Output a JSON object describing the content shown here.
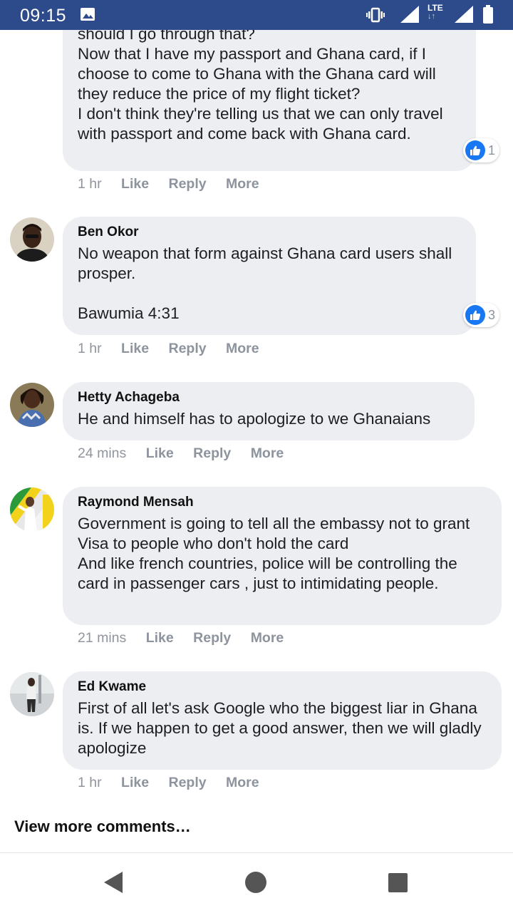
{
  "status_bar": {
    "time": "09:15",
    "network": "LTE",
    "icons": [
      "image-icon",
      "vibrate-icon",
      "signal-icon",
      "lte-signal-icon",
      "battery-icon"
    ]
  },
  "comments": [
    {
      "author": "",
      "text": "should I go through that?\nNow that I have my passport and Ghana card, if I choose to come to Ghana with the Ghana card will they reduce the price of my flight ticket?\nI don't think they're telling us that we can only travel with passport and come back with Ghana card.",
      "time": "1 hr",
      "reactions": "1"
    },
    {
      "author": "Ben Okor",
      "text": "No weapon that form against Ghana card users shall prosper.\n\nBawumia 4:31",
      "time": "1 hr",
      "reactions": "3"
    },
    {
      "author": "Hetty Achageba",
      "text": "He and himself has to apologize to we Ghanaians",
      "time": "24 mins"
    },
    {
      "author": "Raymond Mensah",
      "text": "Government is going to tell all the embassy not to grant Visa to people who don't hold the card\nAnd like french countries, police will be controlling the card in passenger cars , just to intimidating people.",
      "time": "21 mins"
    },
    {
      "author": "Ed Kwame",
      "text": "First of all let's ask Google who the biggest liar in Ghana is. If we happen to get a good answer, then we will gladly apologize",
      "time": "1 hr"
    }
  ],
  "actions": {
    "like": "Like",
    "reply": "Reply",
    "more": "More"
  },
  "view_more": "View more comments…",
  "colors": {
    "status_bar": "#2d4a8a",
    "bubble": "#eceef2",
    "like_blue": "#1877f2"
  },
  "nav": {
    "icons": [
      "back-icon",
      "home-icon",
      "recents-icon"
    ]
  }
}
